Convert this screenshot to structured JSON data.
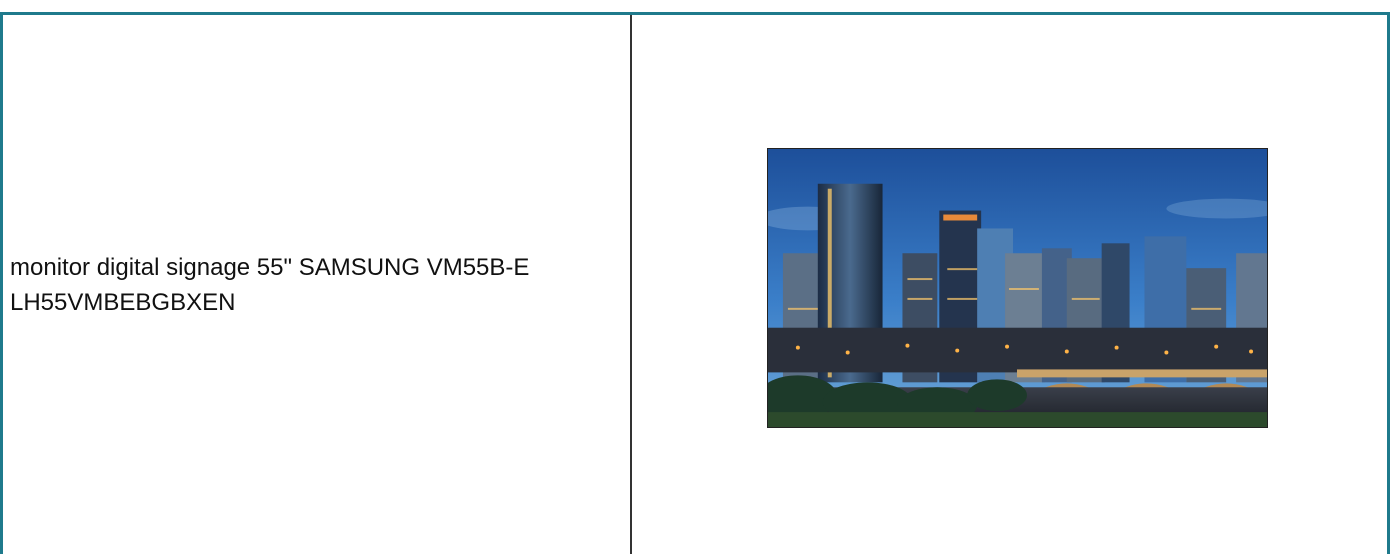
{
  "product": {
    "title": "monitor digital signage 55\" SAMSUNG VM55B-E LH55VMBEBGBXEN",
    "image_alt": "Samsung VM55B-E monitor showing city skyline at night"
  },
  "colors": {
    "frame_border": "#1f7a8c",
    "divider": "#333333",
    "text": "#111111"
  }
}
